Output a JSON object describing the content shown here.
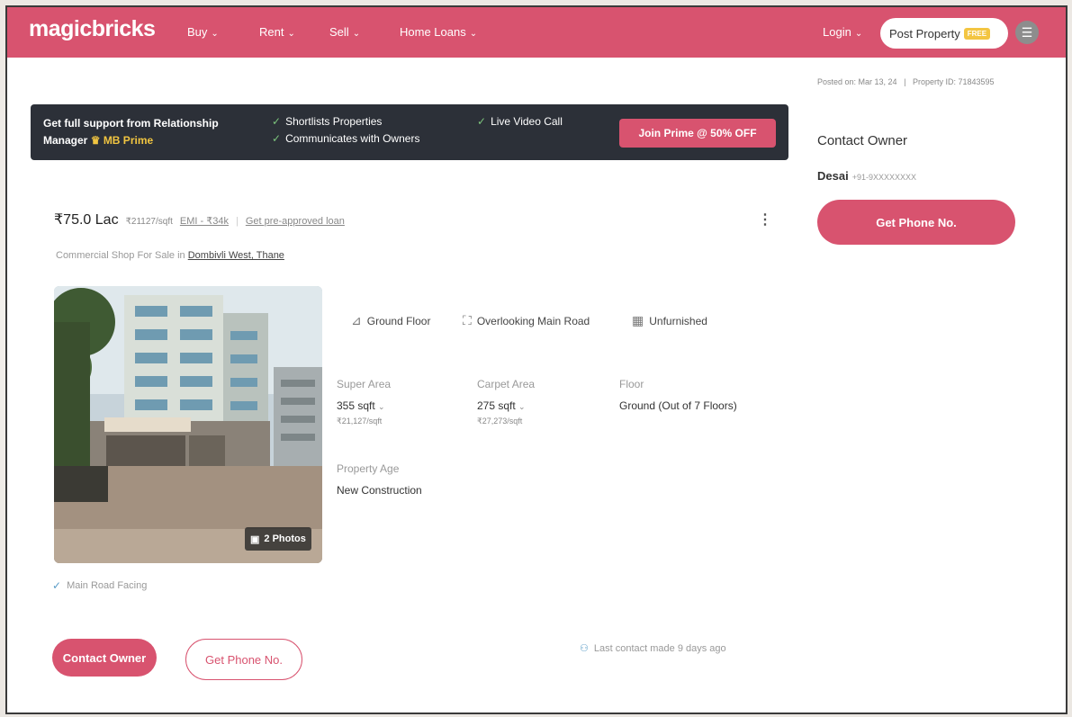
{
  "header": {
    "logo": "magicbricks",
    "nav": [
      {
        "label": "Buy"
      },
      {
        "label": "Rent"
      },
      {
        "label": "Sell"
      },
      {
        "label": "Home Loans"
      }
    ],
    "login": "Login",
    "post_property": "Post Property",
    "free_badge": "FREE"
  },
  "prime_banner": {
    "line1": "Get full support from Relationship",
    "line2_prefix": "Manager",
    "line2_brand": "MB Prime",
    "features": [
      "Shortlists Properties",
      "Communicates with Owners",
      "Live Video Call"
    ],
    "button": "Join Prime @ 50% OFF"
  },
  "meta": {
    "posted": "Posted on: Mar 13, 24",
    "property_id": "Property ID: 71843595"
  },
  "contact_card": {
    "title": "Contact Owner",
    "name": "Desai",
    "phone": "+91-9XXXXXXXX",
    "button": "Get Phone No."
  },
  "listing": {
    "price": "₹75.0 Lac",
    "rate": "₹21127/sqft",
    "emi": "EMI - ₹34k",
    "separator": "|",
    "loan": "Get pre-approved loan",
    "subtitle_prefix": "Commercial Shop For Sale in",
    "location": "Dombivli West, Thane",
    "photos_badge": "2 Photos",
    "features": [
      "Ground Floor",
      "Overlooking Main Road",
      "Unfurnished"
    ],
    "specs": {
      "super_area_label": "Super Area",
      "super_area_value": "355 sqft",
      "super_area_rate": "₹21,127/sqft",
      "carpet_area_label": "Carpet Area",
      "carpet_area_value": "275 sqft",
      "carpet_area_rate": "₹27,273/sqft",
      "floor_label": "Floor",
      "floor_value": "Ground (Out of 7 Floors)",
      "age_label": "Property Age",
      "age_value": "New Construction"
    },
    "highlight": "Main Road Facing",
    "contact_button": "Contact Owner",
    "phone_button": "Get Phone No.",
    "last_contact": "Last contact made 9 days ago"
  },
  "colors": {
    "brand": "#d8536f",
    "banner": "#2c3038",
    "gold": "#f1c541"
  },
  "icons": {
    "menu": "hamburger-icon",
    "kebab": "kebab-icon",
    "floor": "stairs-icon",
    "road": "road-icon",
    "furnish": "grid-icon",
    "photo": "photo-icon",
    "check": "check-circle-icon",
    "user": "user-icon"
  }
}
